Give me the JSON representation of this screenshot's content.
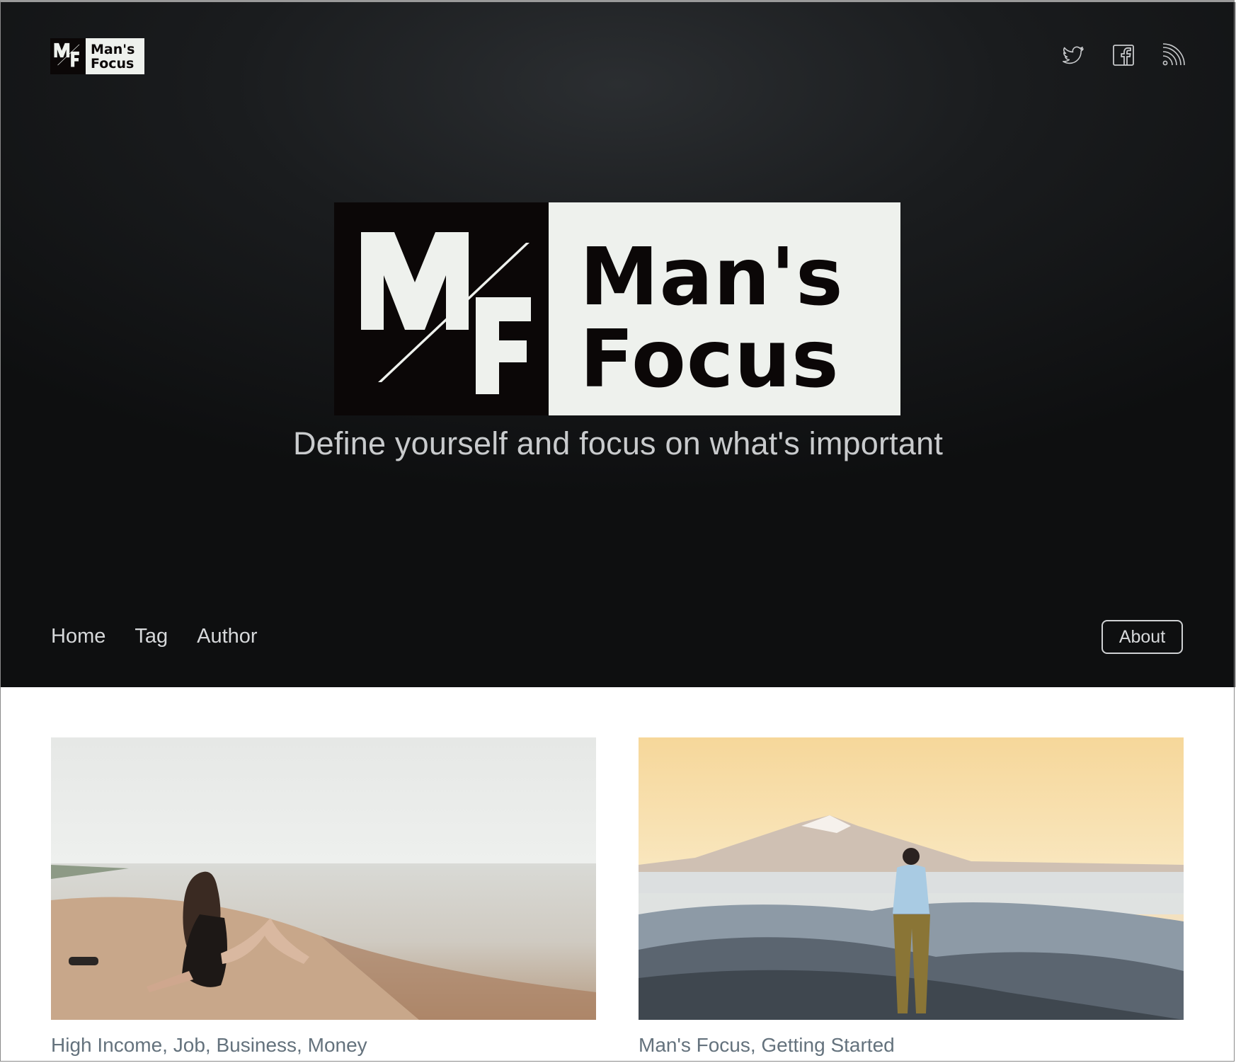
{
  "brand": {
    "name_line1": "Man's",
    "name_line2": "Focus",
    "mark_letters": "MF",
    "colors": {
      "dark": "#0b0707",
      "light": "#eef1ed"
    }
  },
  "header": {
    "social_icons": [
      "twitter-icon",
      "facebook-icon",
      "rss-icon"
    ]
  },
  "hero": {
    "tagline": "Define yourself and focus on what's important"
  },
  "nav": {
    "items": [
      "Home",
      "Tag",
      "Author"
    ],
    "about_label": "About"
  },
  "posts": [
    {
      "tags": "High Income, Job, Business, Money",
      "image": "woman-sitting-on-beach-photo"
    },
    {
      "tags": "Man's Focus, Getting Started",
      "image": "man-overlooking-mountains-photo"
    }
  ]
}
